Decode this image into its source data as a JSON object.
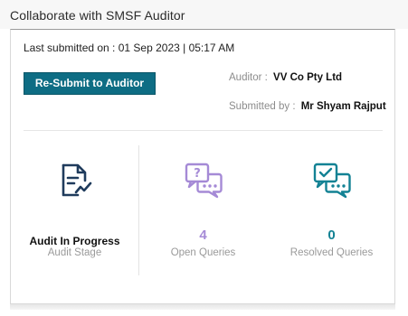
{
  "header": {
    "title": "Collaborate with SMSF Auditor"
  },
  "card": {
    "last_submitted_label": "Last submitted on : 01 Sep 2023 | 05:17 AM",
    "resubmit_button_label": "Re-Submit to Auditor",
    "auditor_label": "Auditor :",
    "auditor_value": "VV Co Pty Ltd",
    "submitted_by_label": "Submitted by :",
    "submitted_by_value": "Mr Shyam Rajput"
  },
  "stats": {
    "audit_stage": {
      "icon": "document-chart-icon",
      "value": "Audit In Progress",
      "label": "Audit Stage"
    },
    "open_queries": {
      "icon": "question-chat-icon",
      "value": "4",
      "label": "Open Queries",
      "color": "#a58ad6"
    },
    "resolved_queries": {
      "icon": "check-chat-icon",
      "value": "0",
      "label": "Resolved Queries",
      "color": "#138294"
    }
  },
  "colors": {
    "primary_button": "#0e6d84",
    "document_icon": "#1f3b5c",
    "open_queries": "#a58ad6",
    "resolved_queries": "#138294"
  }
}
